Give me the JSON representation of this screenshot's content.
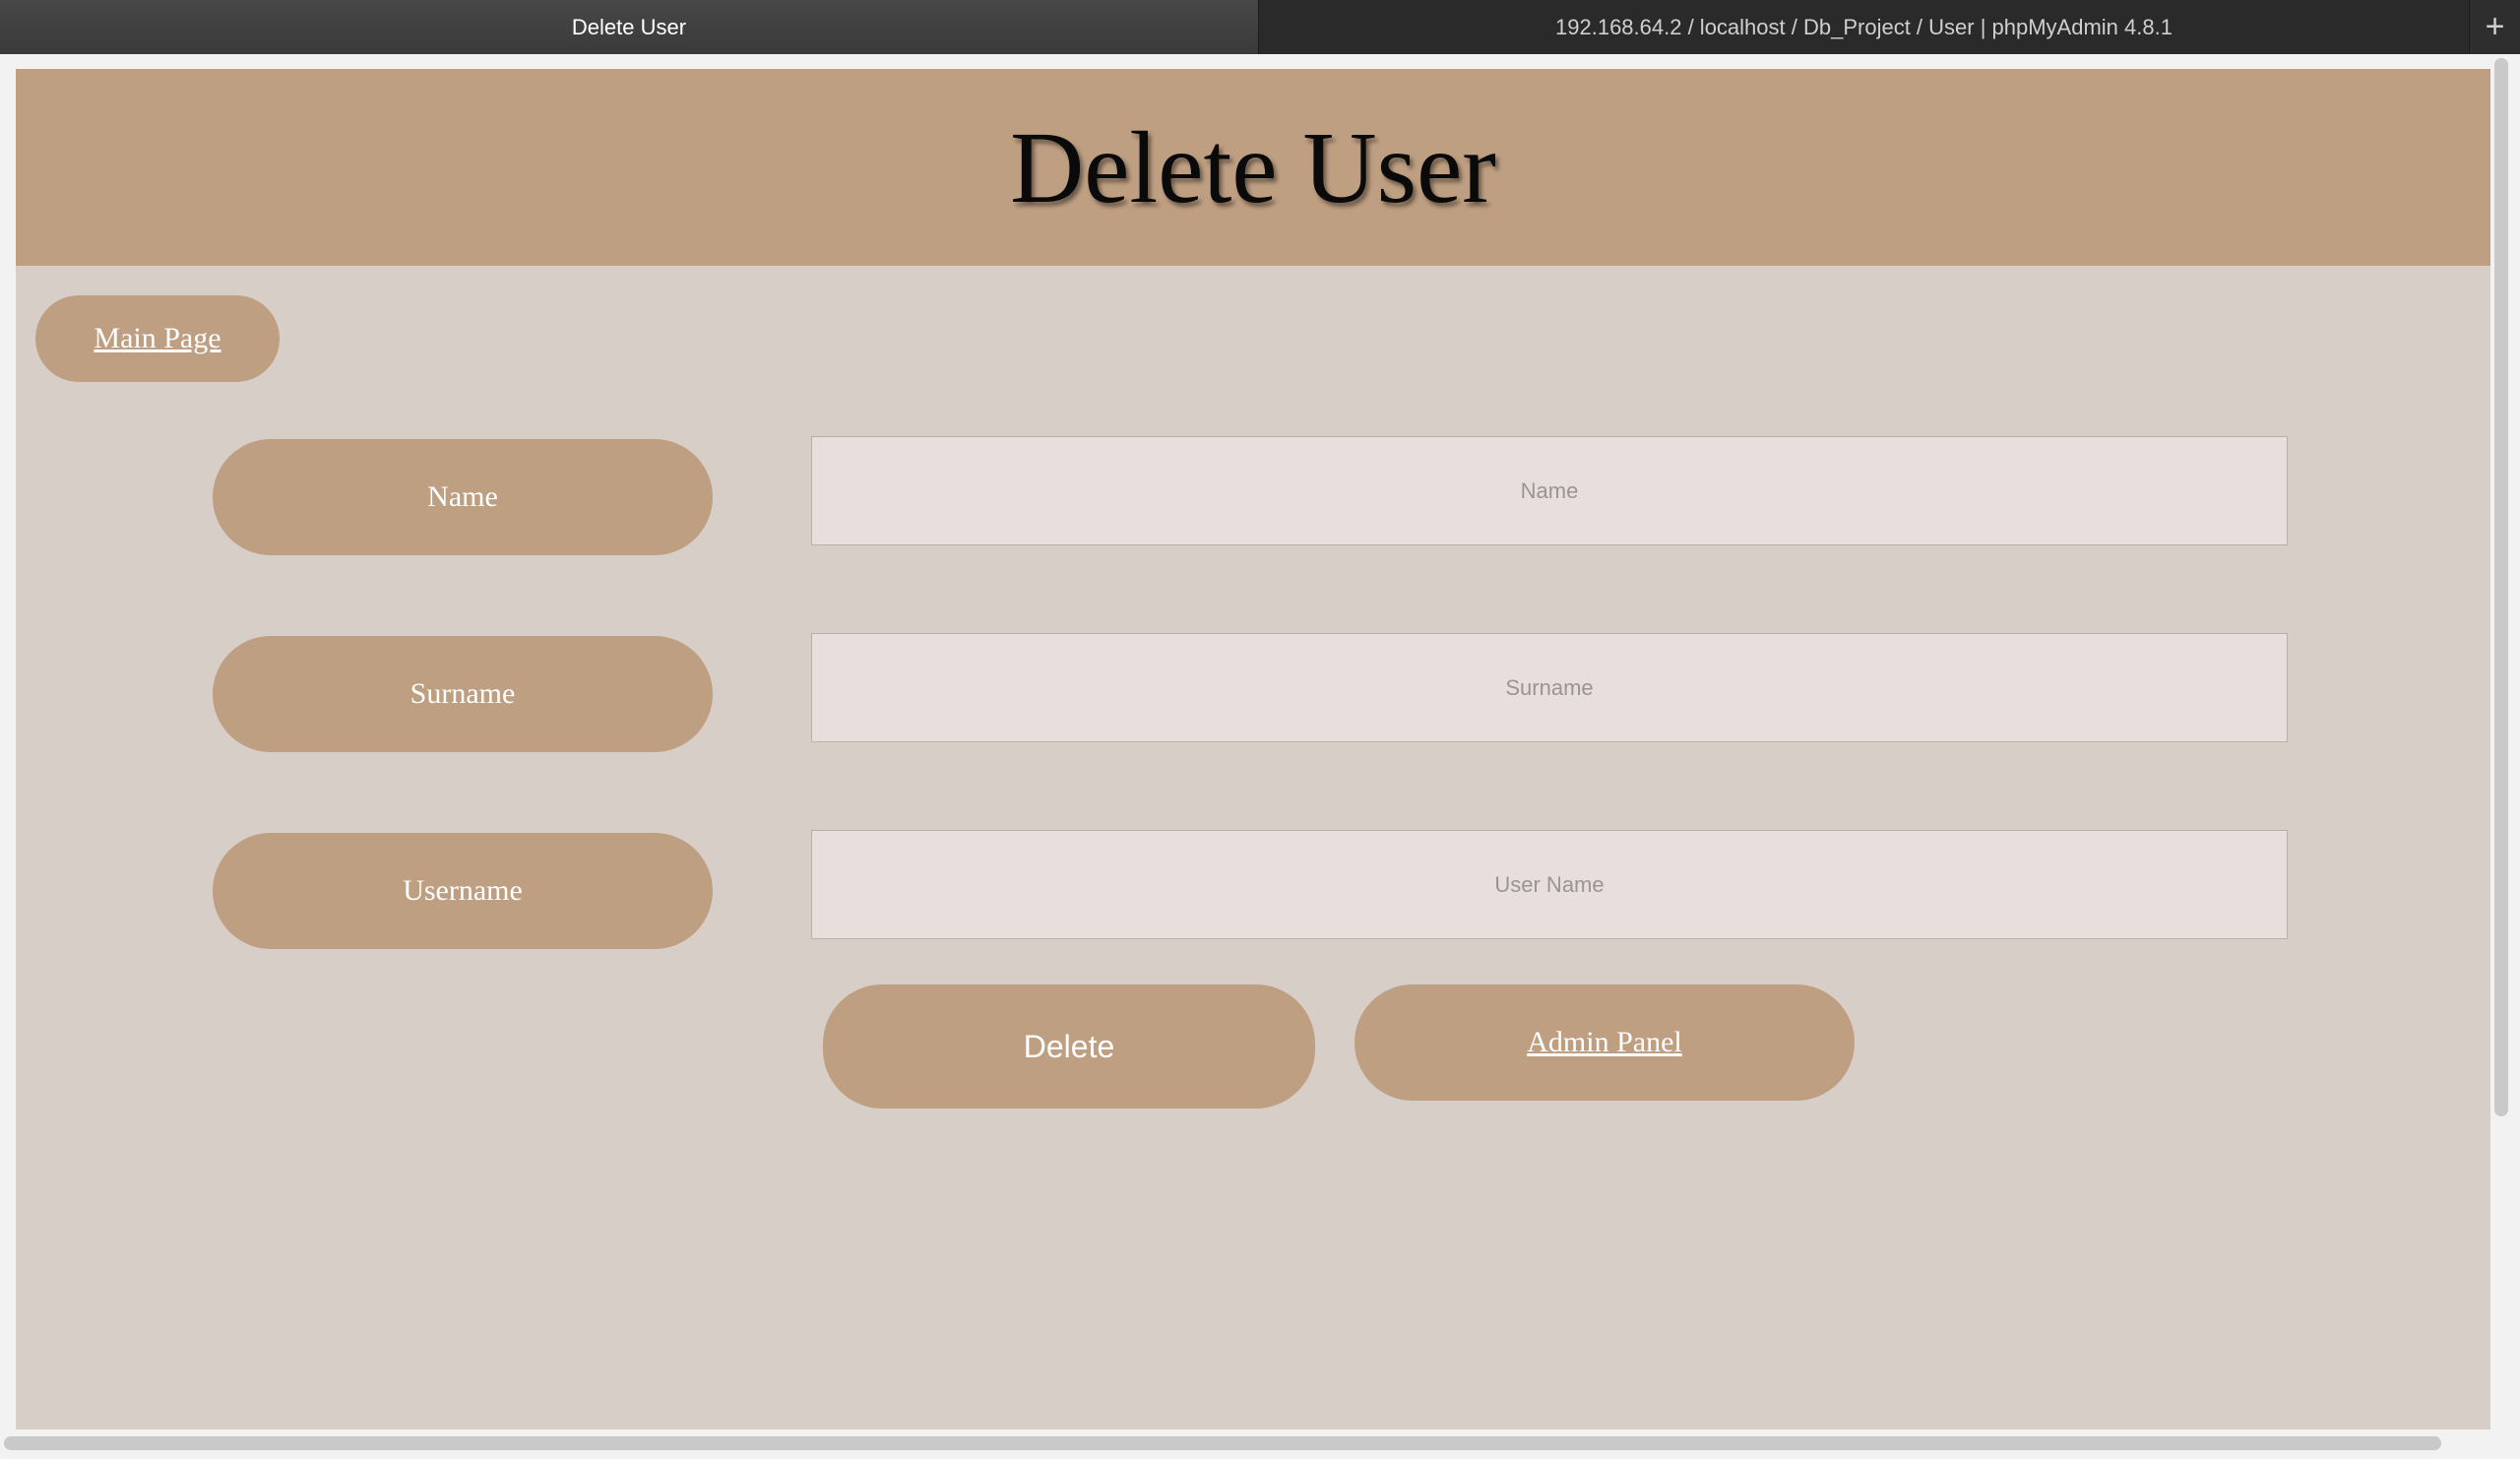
{
  "browser": {
    "tabs": [
      {
        "title": "Delete User",
        "active": true
      },
      {
        "title": "192.168.64.2 / localhost / Db_Project / User | phpMyAdmin 4.8.1",
        "active": false
      }
    ],
    "new_tab_glyph": "+"
  },
  "page": {
    "title": "Delete User",
    "main_page_link": "Main Page",
    "fields": [
      {
        "label": "Name",
        "placeholder": "Name",
        "value": ""
      },
      {
        "label": "Surname",
        "placeholder": "Surname",
        "value": ""
      },
      {
        "label": "Username",
        "placeholder": "User Name",
        "value": ""
      }
    ],
    "delete_button": "Delete",
    "admin_panel_link": "Admin Panel"
  },
  "colors": {
    "accent": "#bf9f82",
    "background": "#d8cec8",
    "input_bg": "#e8dfdd"
  }
}
